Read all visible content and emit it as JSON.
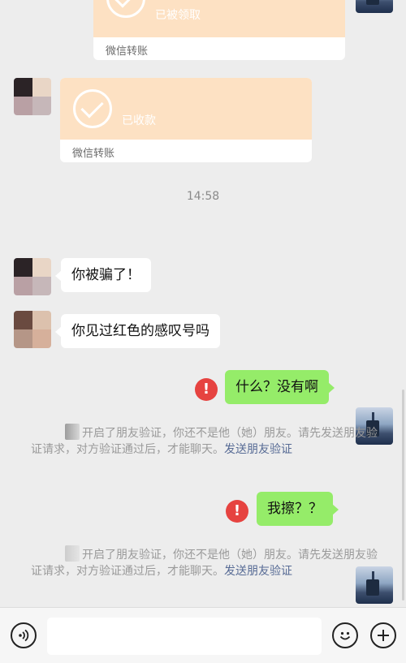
{
  "messages": {
    "transfer1": {
      "status": "已被领取",
      "label": "微信转账"
    },
    "transfer2": {
      "status": "已收款",
      "label": "微信转账"
    },
    "timestamp": "14:58",
    "msg1": "你被骗了！",
    "msg2": "你见过红色的感叹号吗",
    "sent1": "什么？没有啊",
    "sent2": "我擦？？",
    "error_icon": "!",
    "system1": {
      "text": "开启了朋友验证，你还不是他（她）朋友。请先发送朋友验证请求，对方验证通过后，才能聊天。",
      "link": "发送朋友验证"
    },
    "system2": {
      "text": "开启了朋友验证，你还不是他（她）朋友。请先发送朋友验证请求，对方验证通过后，才能聊天。",
      "link": "发送朋友验证"
    }
  },
  "input_bar": {
    "voice_icon": "voice-icon",
    "emoji_icon": "emoji-icon",
    "plus_icon": "plus-icon",
    "text_value": ""
  },
  "colors": {
    "background": "#ededed",
    "sent_bubble": "#95ec69",
    "transfer_header": "#fde1c3",
    "error": "#e64340",
    "link": "#576b95"
  }
}
